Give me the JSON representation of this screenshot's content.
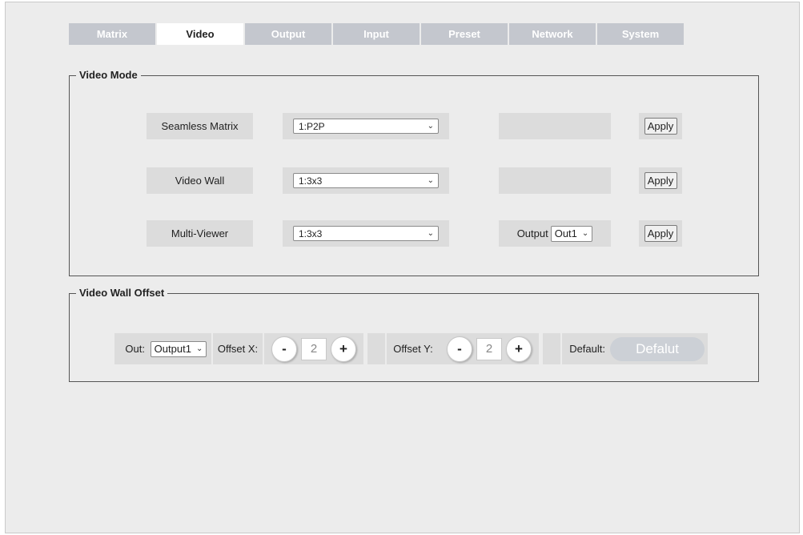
{
  "tabs": [
    {
      "label": "Matrix"
    },
    {
      "label": "Video"
    },
    {
      "label": "Output"
    },
    {
      "label": "Input"
    },
    {
      "label": "Preset"
    },
    {
      "label": "Network"
    },
    {
      "label": "System"
    }
  ],
  "video_mode": {
    "legend": "Video Mode",
    "rows": [
      {
        "label": "Seamless Matrix",
        "value": "1:P2P",
        "apply": "Apply"
      },
      {
        "label": "Video Wall",
        "value": "1:3x3",
        "apply": "Apply"
      },
      {
        "label": "Multi-Viewer",
        "value": "1:3x3",
        "output_label": "Output",
        "output_value": "Out1",
        "apply": "Apply"
      }
    ]
  },
  "offset": {
    "legend": "Video Wall Offset",
    "out_label": "Out:",
    "out_value": "Output1",
    "offset_x_label": "Offset X:",
    "offset_x_value": "2",
    "offset_y_label": "Offset Y:",
    "offset_y_value": "2",
    "minus": "-",
    "plus": "+",
    "default_label": "Default:",
    "default_button": "Defalut"
  }
}
